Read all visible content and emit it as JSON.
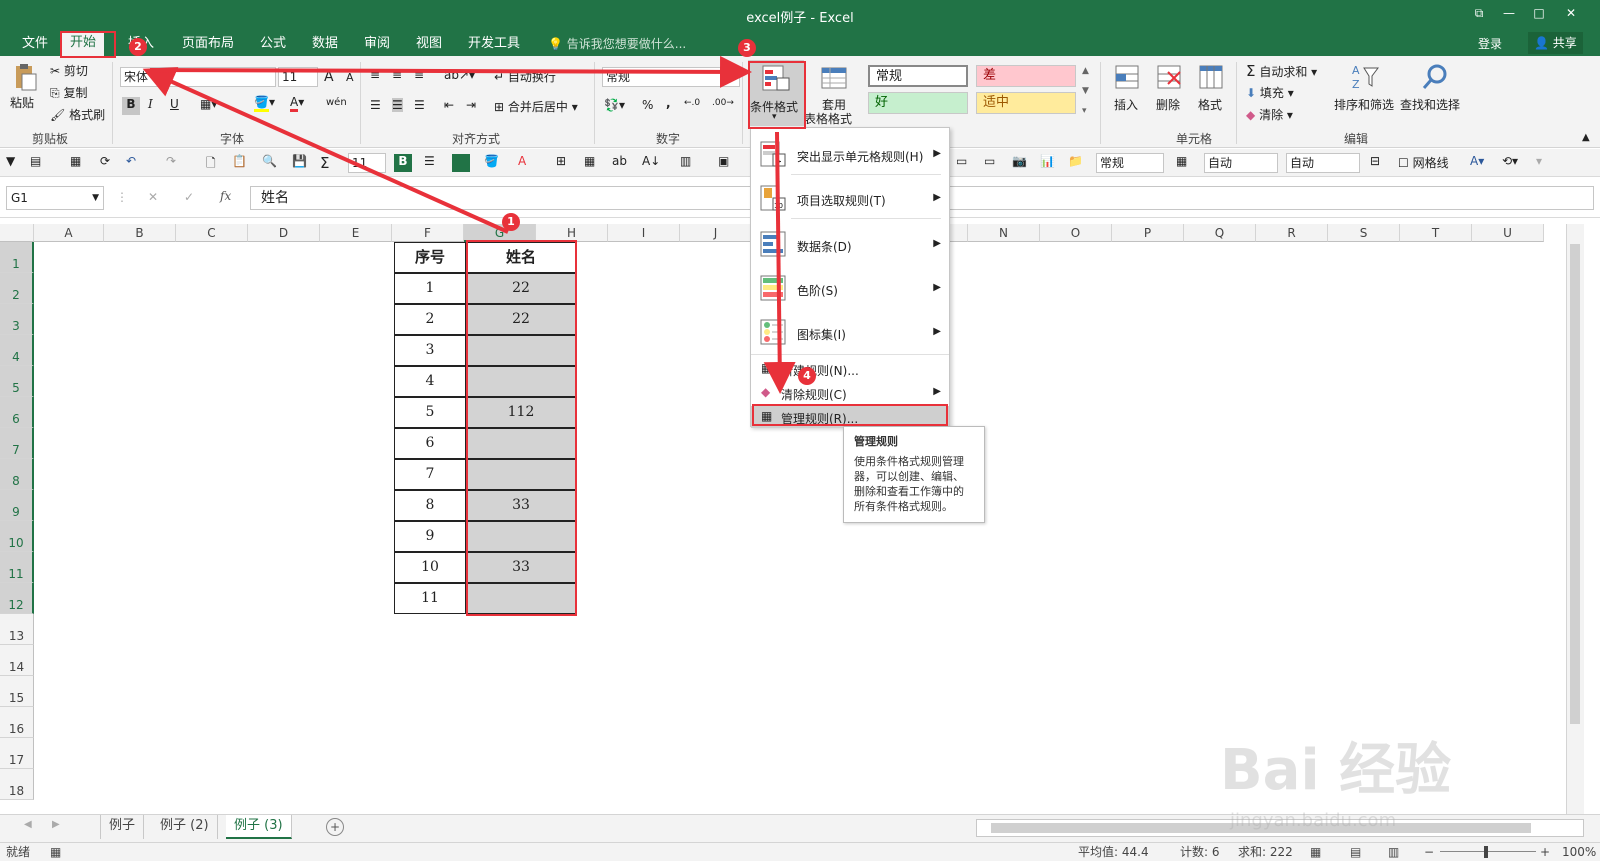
{
  "window": {
    "title": "excel例子 - Excel",
    "restore_icon": "⧉",
    "minimize": "—",
    "maximize": "□",
    "close": "✕"
  },
  "tabs": [
    "文件",
    "开始",
    "插入",
    "页面布局",
    "公式",
    "数据",
    "审阅",
    "视图",
    "开发工具"
  ],
  "tell_me": "告诉我您想要做什么...",
  "login": "登录",
  "share": "共享",
  "ribbon": {
    "clipboard": {
      "paste": "粘贴",
      "cut": "剪切",
      "copy": "复制",
      "format_painter": "格式刷",
      "label": "剪贴板"
    },
    "font": {
      "name": "宋体",
      "size": "11",
      "bold": "B",
      "italic": "I",
      "underline": "U",
      "label": "字体",
      "grow": "A",
      "shrink": "A",
      "phonetic": "wén"
    },
    "alignment": {
      "wrap": "自动换行",
      "merge": "合并后居中",
      "label": "对齐方式"
    },
    "number": {
      "format": "常规",
      "percent": "%",
      "comma": ",",
      "label": "数字"
    },
    "styles": {
      "conditional": "条件格式",
      "table_format_1": "套用",
      "table_format_2": "表格格式",
      "normal": "常规",
      "bad": "差",
      "good": "好",
      "neutral": "适中"
    },
    "cells": {
      "insert": "插入",
      "delete": "删除",
      "format": "格式",
      "label": "单元格"
    },
    "editing": {
      "autosum": "自动求和",
      "fill": "填充",
      "clear": "清除",
      "sort": "排序和筛选",
      "find": "查找和选择",
      "label": "编辑"
    }
  },
  "qat": {
    "font_size": "11",
    "style": "常规",
    "auto1": "自动",
    "auto2": "自动",
    "gridlines": "网格线"
  },
  "formula_bar": {
    "name_box": "G1",
    "fx": "fx",
    "value": "姓名"
  },
  "columns": [
    "A",
    "B",
    "C",
    "D",
    "E",
    "F",
    "G",
    "H",
    "I",
    "J",
    "K",
    "L",
    "M",
    "N",
    "O",
    "P",
    "Q",
    "R",
    "S",
    "T",
    "U"
  ],
  "rows": [
    "1",
    "2",
    "3",
    "4",
    "5",
    "6",
    "7",
    "8",
    "9",
    "10",
    "11",
    "12",
    "13",
    "14",
    "15",
    "16",
    "17",
    "18"
  ],
  "table": {
    "headers": [
      "序号",
      "姓名"
    ],
    "rows": [
      [
        "1",
        "22"
      ],
      [
        "2",
        "22"
      ],
      [
        "3",
        ""
      ],
      [
        "4",
        ""
      ],
      [
        "5",
        "112"
      ],
      [
        "6",
        ""
      ],
      [
        "7",
        ""
      ],
      [
        "8",
        "33"
      ],
      [
        "9",
        ""
      ],
      [
        "10",
        "33"
      ],
      [
        "11",
        ""
      ]
    ]
  },
  "menu": {
    "items": [
      "突出显示单元格规则(H)",
      "项目选取规则(T)",
      "数据条(D)",
      "色阶(S)",
      "图标集(I)",
      "新建规则(N)...",
      "清除规则(C)",
      "管理规则(R)..."
    ]
  },
  "tooltip": {
    "title": "管理规则",
    "body": "使用条件格式规则管理器，可以创建、编辑、删除和查看工作簿中的所有条件格式规则。"
  },
  "sheets": [
    "例子",
    "例子 (2)",
    "例子 (3)"
  ],
  "status": {
    "ready": "就绪",
    "average": "平均值: 44.4",
    "count": "计数: 6",
    "sum": "求和: 222",
    "zoom": "100%"
  },
  "badges": [
    "1",
    "2",
    "3",
    "4"
  ],
  "watermark": {
    "logo": "Bai 经验",
    "url": "jingyan.baidu.com"
  },
  "colors": {
    "accent": "#217346",
    "annotation": "#e8313a",
    "bad_bg": "#ffc7ce",
    "good_bg": "#c6efce",
    "neutral_bg": "#ffeb9c"
  }
}
